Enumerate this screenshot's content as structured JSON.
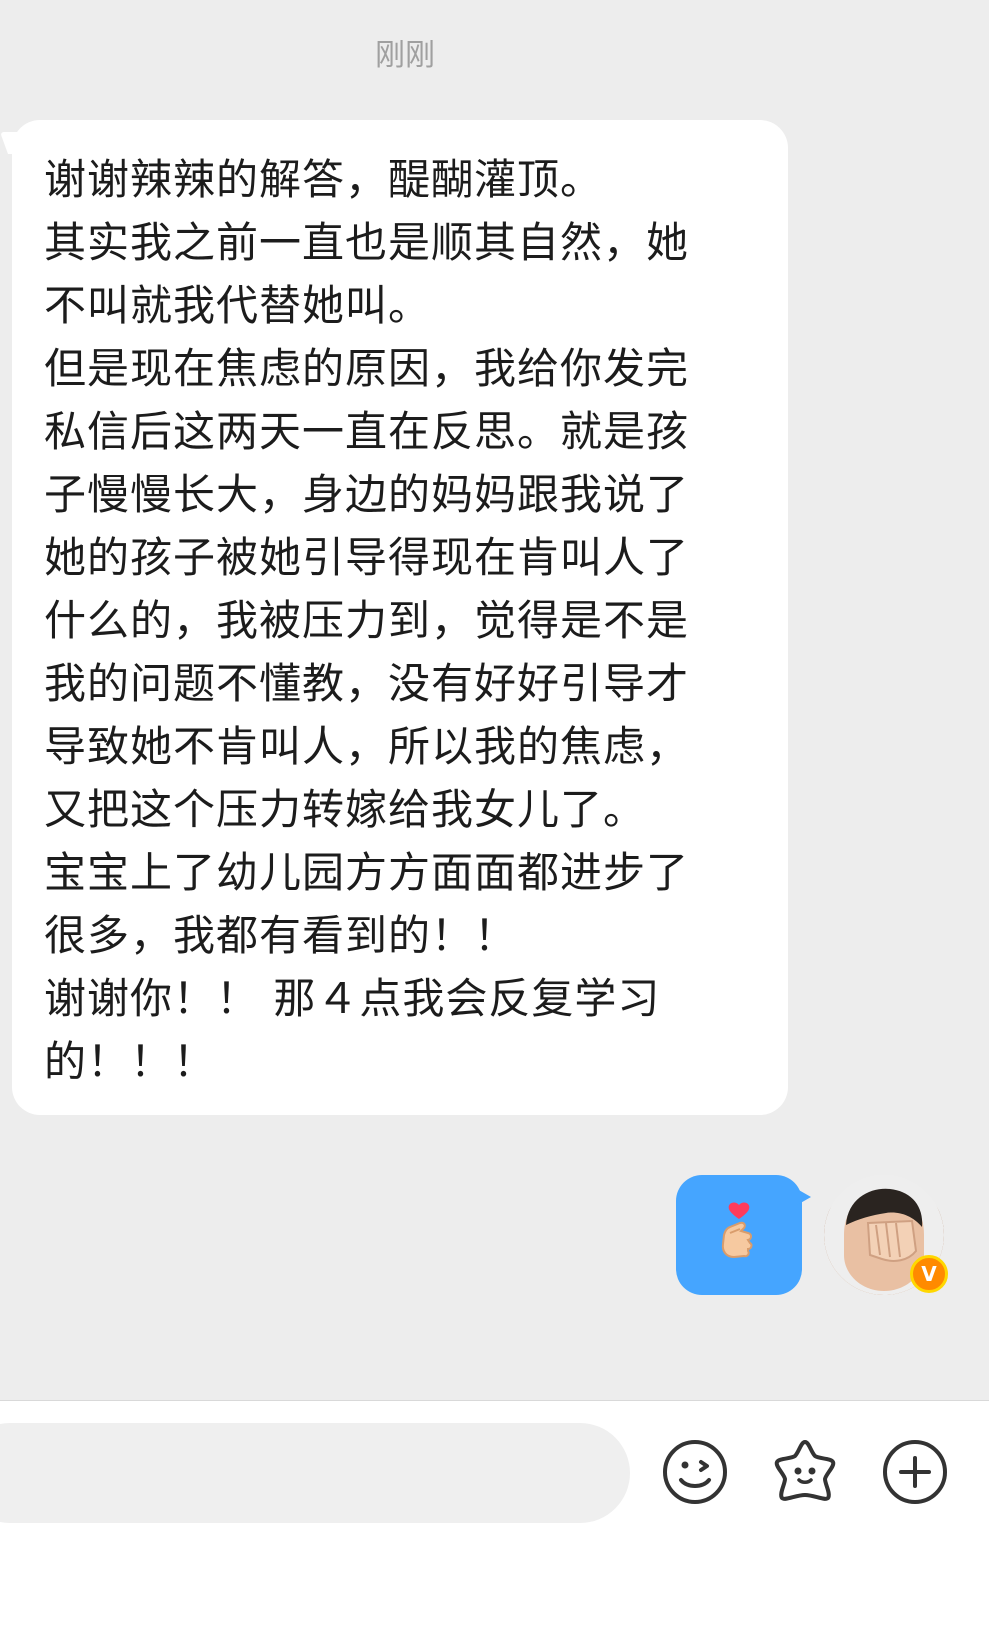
{
  "chat": {
    "timestamp": "刚刚",
    "incoming_message": {
      "lines": [
        "谢谢辣辣的解答，醍醐灌顶。",
        "其实我之前一直也是顺其自然，她",
        "不叫就我代替她叫。",
        "但是现在焦虑的原因，我给你发完",
        "私信后这两天一直在反思。就是孩",
        "子慢慢长大，身边的妈妈跟我说了",
        "她的孩子被她引导得现在肯叫人了",
        "什么的，我被压力到，觉得是不是",
        "我的问题不懂教，没有好好引导才",
        "导致她不肯叫人，所以我的焦虑，",
        "又把这个压力转嫁给我女儿了。",
        "宝宝上了幼儿园方方面面都进步了",
        "很多，我都有看到的！！",
        "谢谢你！！ 那４点我会反复学习",
        "的！！！"
      ]
    },
    "outgoing_message": {
      "content_icon": "finger-heart-emoji",
      "bubble_color": "#45a5ff"
    },
    "sender_avatar": {
      "badge_text": "V",
      "badge_color": "#ff8a00"
    }
  },
  "input_bar": {
    "icons": [
      "emoji-icon",
      "sticker-icon",
      "plus-icon"
    ]
  }
}
